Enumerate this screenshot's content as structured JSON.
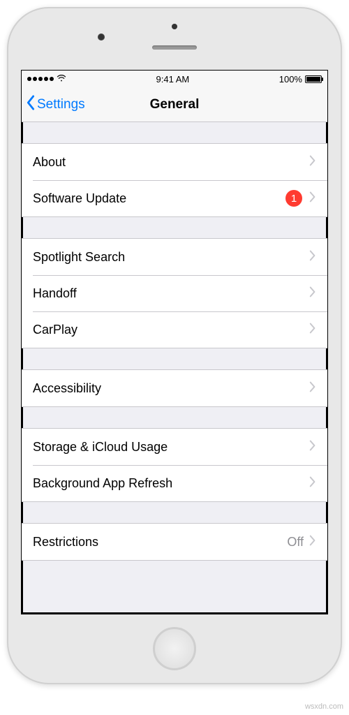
{
  "status_bar": {
    "time": "9:41 AM",
    "battery_percent": "100%"
  },
  "nav": {
    "back_label": "Settings",
    "title": "General"
  },
  "groups": {
    "g1": {
      "about": "About",
      "software_update": "Software Update",
      "software_update_badge": "1"
    },
    "g2": {
      "spotlight": "Spotlight Search",
      "handoff": "Handoff",
      "carplay": "CarPlay"
    },
    "g3": {
      "accessibility": "Accessibility"
    },
    "g4": {
      "storage": "Storage & iCloud Usage",
      "background_refresh": "Background App Refresh"
    },
    "g5": {
      "restrictions": "Restrictions",
      "restrictions_value": "Off"
    }
  },
  "watermark": "wsxdn.com"
}
